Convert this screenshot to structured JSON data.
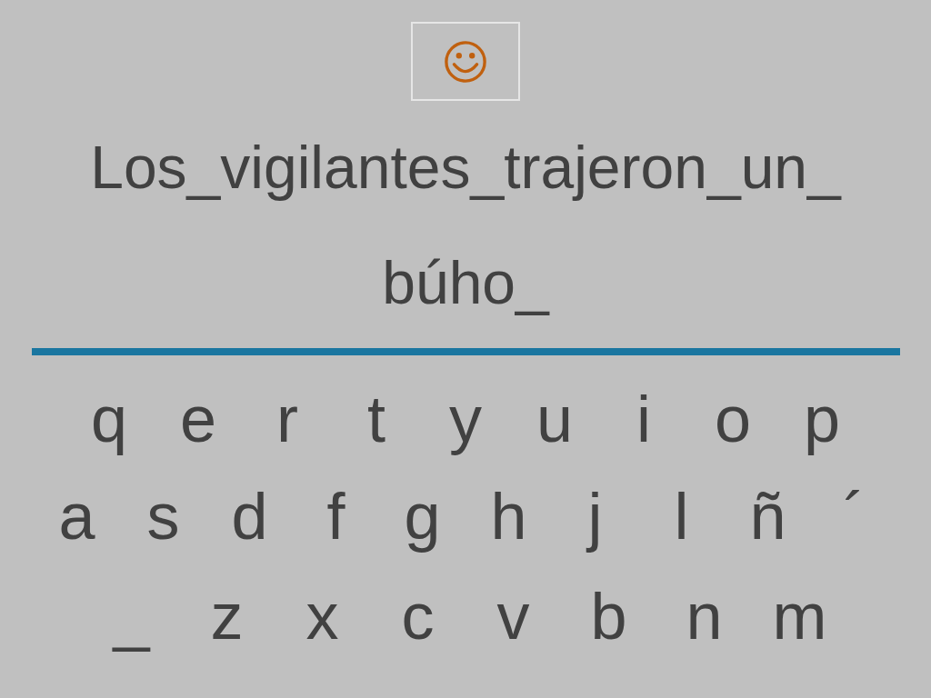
{
  "sentence_lines": [
    "Los_vigilantes_trajeron_un_",
    "búho_"
  ],
  "keyboard_rows": [
    [
      "q",
      "e",
      "r",
      "t",
      "y",
      "u",
      "i",
      "o",
      "p"
    ],
    [
      "a",
      "s",
      "d",
      "f",
      "g",
      "h",
      "j",
      "l",
      "ñ",
      "´"
    ],
    [
      "_",
      "z",
      "x",
      "c",
      "v",
      "b",
      "n",
      "m"
    ]
  ]
}
